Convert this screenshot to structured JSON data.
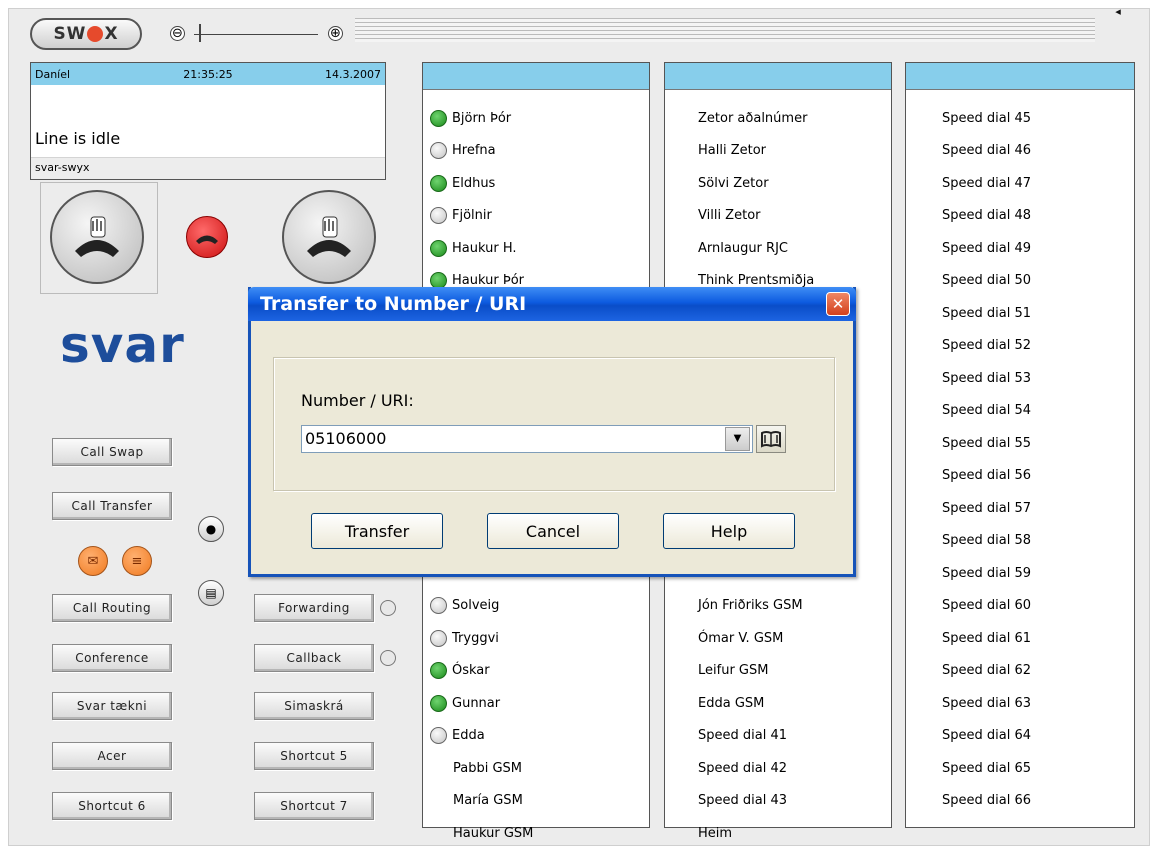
{
  "topbar": {
    "logo_text": "SW",
    "logo_text_end": "X",
    "zoom_minus": "⊖",
    "zoom_plus": "⊕",
    "corner_glyph": "◂"
  },
  "status": {
    "name": "Daníel",
    "time": "21:35:25",
    "date": "14.3.2007",
    "line_state": "Line is idle",
    "account": "svar-swyx"
  },
  "brand": {
    "text": "svar"
  },
  "buttons": {
    "call_swap": "Call Swap",
    "call_transfer": "Call Transfer",
    "call_routing": "Call Routing",
    "conference": "Conference",
    "svar_taekni": "Svar tækni",
    "acer": "Acer",
    "shortcut6": "Shortcut 6",
    "forwarding": "Forwarding",
    "callback": "Callback",
    "simaskra": "Simaskrá",
    "shortcut5": "Shortcut 5",
    "shortcut7": "Shortcut 7"
  },
  "col1": {
    "top": [
      {
        "label": "Björn Þór",
        "status": "on"
      },
      {
        "label": "Hrefna",
        "status": "off"
      },
      {
        "label": "Eldhus",
        "status": "on"
      },
      {
        "label": "Fjölnir",
        "status": "off"
      },
      {
        "label": "Haukur H.",
        "status": "on"
      },
      {
        "label": "Haukur Þór",
        "status": "on"
      }
    ],
    "bottom": [
      {
        "label": "Solveig",
        "status": "off"
      },
      {
        "label": "Tryggvi",
        "status": "off"
      },
      {
        "label": "Óskar",
        "status": "on"
      },
      {
        "label": "Gunnar",
        "status": "on"
      },
      {
        "label": "Edda",
        "status": "off"
      },
      {
        "label": "Pabbi GSM",
        "status": "none"
      },
      {
        "label": "María GSM",
        "status": "none"
      },
      {
        "label": "Haukur GSM",
        "status": "none"
      }
    ]
  },
  "col2": {
    "top": [
      "Zetor aðalnúmer",
      "Halli Zetor",
      "Sölvi Zetor",
      "Villi Zetor",
      "Arnlaugur RJC",
      "Think Prentsmiðja"
    ],
    "bottom": [
      "Jón Friðriks GSM",
      "Ómar V. GSM",
      "Leifur GSM",
      "Edda GSM",
      "Speed dial 41",
      "Speed dial 42",
      "Speed dial 43",
      "Heim"
    ]
  },
  "col3": [
    "Speed dial 45",
    "Speed dial 46",
    "Speed dial 47",
    "Speed dial 48",
    "Speed dial 49",
    "Speed dial 50",
    "Speed dial 51",
    "Speed dial 52",
    "Speed dial 53",
    "Speed dial 54",
    "Speed dial 55",
    "Speed dial 56",
    "Speed dial 57",
    "Speed dial 58",
    "Speed dial 59",
    "Speed dial 60",
    "Speed dial 61",
    "Speed dial 62",
    "Speed dial 63",
    "Speed dial 64",
    "Speed dial 65",
    "Speed dial 66"
  ],
  "dialog": {
    "title": "Transfer to Number / URI",
    "close": "✕",
    "field_label": "Number / URI:",
    "field_value": "05106000",
    "transfer": "Transfer",
    "cancel": "Cancel",
    "help": "Help"
  },
  "colors": {
    "header_blue": "#87ceeb",
    "brand_blue": "#1d4d9b",
    "online_green": "#1a8a1a",
    "title_blue": "#0a4dc8"
  }
}
